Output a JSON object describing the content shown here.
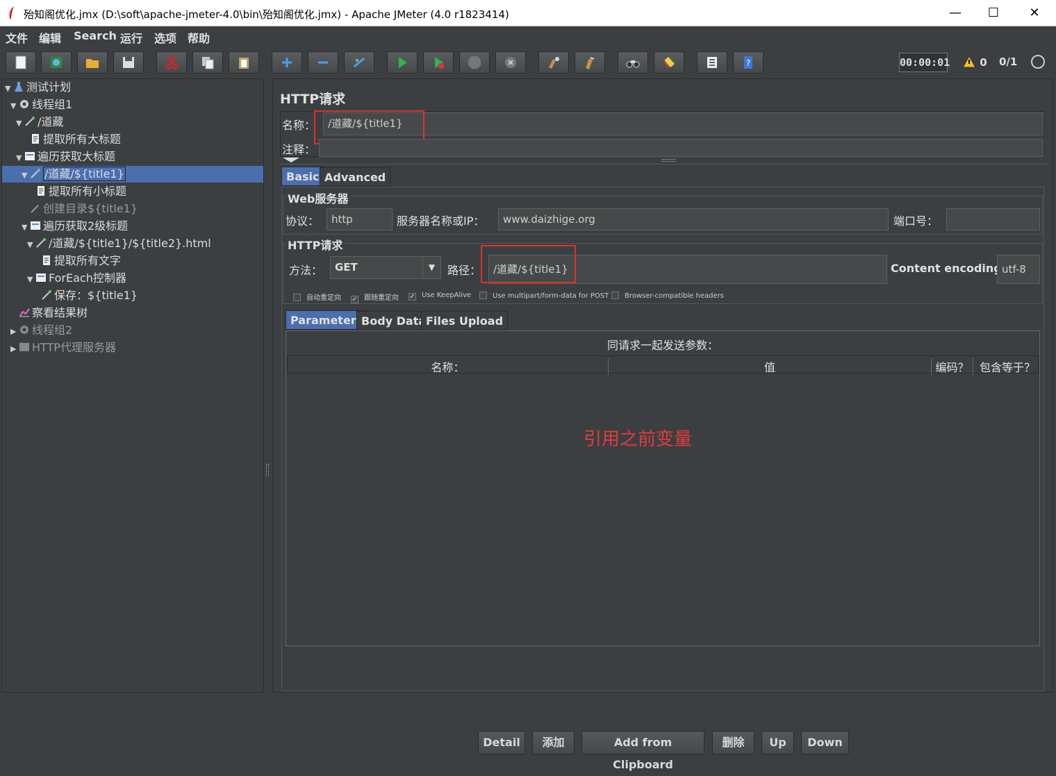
{
  "window": {
    "title": "殆知阁优化.jmx (D:\\soft\\apache-jmeter-4.0\\bin\\殆知阁优化.jmx) - Apache JMeter (4.0 r1823414)",
    "minimize": "—",
    "maximize": "☐",
    "close": "✕"
  },
  "menu": [
    "文件",
    "编辑",
    "Search",
    "运行",
    "选项",
    "帮助"
  ],
  "toolbar": {
    "timer": "00:00:01",
    "warnings": "0",
    "threads": "0/1"
  },
  "tree": [
    {
      "label": "测试计划",
      "icon": "flask-icon"
    },
    {
      "label": "线程组1",
      "icon": "gear-icon"
    },
    {
      "label": "/道藏",
      "icon": "pipette-icon"
    },
    {
      "label": "提取所有大标题",
      "icon": "document-icon"
    },
    {
      "label": "遍历获取大标题",
      "icon": "controller-icon"
    },
    {
      "label": "/道藏/${title1}",
      "icon": "pipette-icon"
    },
    {
      "label": "提取所有小标题",
      "icon": "document-icon"
    },
    {
      "label": "创建目录${title1}",
      "icon": "pipette-icon"
    },
    {
      "label": "遍历获取2级标题",
      "icon": "controller-icon"
    },
    {
      "label": "/道藏/${title1}/${title2}.html",
      "icon": "pipette-icon"
    },
    {
      "label": "提取所有文字",
      "icon": "document-icon"
    },
    {
      "label": "ForEach控制器",
      "icon": "controller-icon"
    },
    {
      "label": "保存：${title1}",
      "icon": "pipette-icon"
    },
    {
      "label": "察看结果树",
      "icon": "chart-icon"
    },
    {
      "label": "线程组2",
      "icon": "gear-icon"
    },
    {
      "label": "HTTP代理服务器",
      "icon": "proxy-icon"
    }
  ],
  "panel": {
    "title": "HTTP请求",
    "name_label": "名称：",
    "name_value": "/道藏/${title1}",
    "comment_label": "注释：",
    "tabs": [
      "Basic",
      "Advanced"
    ],
    "web_server": {
      "section": "Web服务器",
      "protocol_label": "协议：",
      "protocol": "http",
      "server_label": "服务器名称或IP：",
      "server": "www.daizhige.org",
      "port_label": "端口号：",
      "port": ""
    },
    "http_request": {
      "section": "HTTP请求",
      "method_label": "方法：",
      "method": "GET",
      "path_label": "路径：",
      "path": "/道藏/${title1}",
      "encoding_label": "Content encoding:",
      "encoding": "utf-8"
    },
    "checkboxes": [
      {
        "label": "自动重定向",
        "checked": false
      },
      {
        "label": "跟随重定向",
        "checked": true
      },
      {
        "label": "Use KeepAlive",
        "checked": true
      },
      {
        "label": "Use multipart/form-data for POST",
        "checked": false
      },
      {
        "label": "Browser-compatible headers",
        "checked": false
      }
    ],
    "subtabs": [
      "Parameters",
      "Body Data",
      "Files Upload"
    ],
    "params_heading": "同请求一起发送参数：",
    "columns": [
      "名称：",
      "值",
      "编码？",
      "包含等于？"
    ],
    "annotation": "引用之前变量",
    "buttons": [
      "Detail",
      "添加",
      "Add from Clipboard",
      "删除",
      "Up",
      "Down"
    ]
  }
}
